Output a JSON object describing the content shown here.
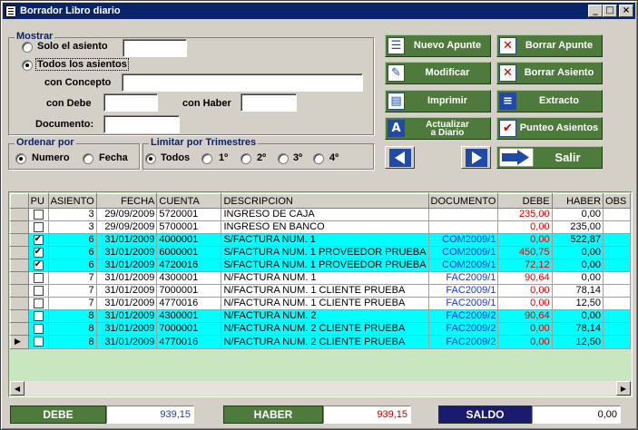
{
  "window": {
    "title": "Borrador Libro diario",
    "minimize": "_",
    "maximize": "□",
    "close": "×"
  },
  "mostrar": {
    "legend": "Mostrar",
    "solo_asiento": "Solo el asiento",
    "todos_asientos": "Todos los asientos",
    "con_concepto": "con Concepto",
    "con_debe": "con Debe",
    "con_haber": "con Haber",
    "documento": "Documento:",
    "selected": "todos_asientos"
  },
  "ordenar": {
    "legend": "Ordenar por",
    "numero": "Numero",
    "fecha": "Fecha",
    "selected": "numero"
  },
  "trimestres": {
    "legend": "Limitar por Trimestres",
    "todos": "Todos",
    "t1": "1º",
    "t2": "2º",
    "t3": "3º",
    "t4": "4º",
    "selected": "todos"
  },
  "buttons": {
    "nuevo_apunte": "Nuevo Apunte",
    "borrar_apunte": "Borrar Apunte",
    "modificar": "Modificar",
    "borrar_asiento": "Borrar Asiento",
    "imprimir": "Imprimir",
    "extracto": "Extracto",
    "actualizar_l1": "Actualizar",
    "actualizar_l2": "a Diario",
    "punteo": "Punteo Asientos",
    "salir": "Salir"
  },
  "grid": {
    "columns": [
      "PU",
      "ASIENTO",
      "FECHA",
      "CUENTA",
      "DESCRIPCION",
      "DOCUMENTO",
      "DEBE",
      "HABER",
      "OBS"
    ],
    "rows": [
      {
        "pu": false,
        "asiento": "3",
        "fecha": "29/09/2009",
        "cuenta": "5720001",
        "descripcion": "INGRESO DE CAJA",
        "documento": "",
        "debe": "235,00",
        "haber": "0,00",
        "highlight": false
      },
      {
        "pu": false,
        "asiento": "3",
        "fecha": "29/09/2009",
        "cuenta": "5700001",
        "descripcion": "INGRESO EN BANCO",
        "documento": "",
        "debe": "0,00",
        "haber": "235,00",
        "highlight": false
      },
      {
        "pu": true,
        "asiento": "6",
        "fecha": "31/01/2009",
        "cuenta": "4000001",
        "descripcion": "S/FACTURA NUM. 1",
        "documento": "COM2009/1",
        "debe": "0,00",
        "haber": "522,87",
        "highlight": true
      },
      {
        "pu": true,
        "asiento": "6",
        "fecha": "31/01/2009",
        "cuenta": "6000001",
        "descripcion": "S/FACTURA NUM. 1 PROVEEDOR PRUEBA",
        "documento": "COM2009/1",
        "debe": "450,75",
        "haber": "0,00",
        "highlight": true
      },
      {
        "pu": true,
        "asiento": "6",
        "fecha": "31/01/2009",
        "cuenta": "4720016",
        "descripcion": "S/FACTURA NUM. 1 PROVEEDOR PRUEBA",
        "documento": "COM2009/1",
        "debe": "72,12",
        "haber": "0,00",
        "highlight": true
      },
      {
        "pu": false,
        "asiento": "7",
        "fecha": "31/01/2009",
        "cuenta": "4300001",
        "descripcion": "N/FACTURA NUM. 1",
        "documento": "FAC2009/1",
        "debe": "90,64",
        "haber": "0,00",
        "highlight": false
      },
      {
        "pu": false,
        "asiento": "7",
        "fecha": "31/01/2009",
        "cuenta": "7000001",
        "descripcion": "N/FACTURA NUM. 1 CLIENTE PRUEBA",
        "documento": "FAC2009/1",
        "debe": "0,00",
        "haber": "78,14",
        "highlight": false
      },
      {
        "pu": false,
        "asiento": "7",
        "fecha": "31/01/2009",
        "cuenta": "4770016",
        "descripcion": "N/FACTURA NUM. 1 CLIENTE PRUEBA",
        "documento": "FAC2009/1",
        "debe": "0,00",
        "haber": "12,50",
        "highlight": false
      },
      {
        "pu": false,
        "asiento": "8",
        "fecha": "31/01/2009",
        "cuenta": "4300001",
        "descripcion": "N/FACTURA NUM. 2",
        "documento": "FAC2009/2",
        "debe": "90,64",
        "haber": "0,00",
        "highlight": true
      },
      {
        "pu": false,
        "asiento": "8",
        "fecha": "31/01/2009",
        "cuenta": "7000001",
        "descripcion": "N/FACTURA NUM. 2 CLIENTE PRUEBA",
        "documento": "FAC2009/2",
        "debe": "0,00",
        "haber": "78,14",
        "highlight": true
      },
      {
        "pu": false,
        "asiento": "8",
        "fecha": "31/01/2009",
        "cuenta": "4770016",
        "descripcion": "N/FACTURA NUM. 2 CLIENTE PRUEBA",
        "documento": "FAC2009/2",
        "debe": "0,00",
        "haber": "12,50",
        "highlight": true,
        "current": true
      }
    ]
  },
  "totals": {
    "debe_label": "DEBE",
    "debe_value": "939,15",
    "haber_label": "HABER",
    "haber_value": "939,15",
    "saldo_label": "SALDO",
    "saldo_value": "0,00"
  },
  "colors": {
    "green_button": "#4e7a3c",
    "titlebar": "#0a246a",
    "highlight_row": "#00ffff",
    "debe_text": "#e00000",
    "doc_text": "#1a3ad0"
  }
}
